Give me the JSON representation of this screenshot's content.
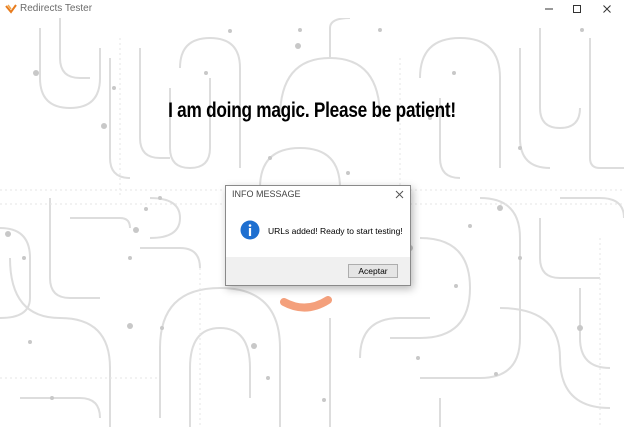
{
  "window": {
    "title": "Redirects Tester",
    "icon": "app-logo-icon"
  },
  "main": {
    "headline": "I am doing magic. Please be patient!"
  },
  "dialog": {
    "title": "INFO MESSAGE",
    "message": "URLs added! Ready to start testing!",
    "ok_label": "Aceptar",
    "icon": "info-icon"
  },
  "colors": {
    "info_icon": "#1e6fd0",
    "smile": "#f4a07c",
    "lines": "#d9d9d9"
  }
}
